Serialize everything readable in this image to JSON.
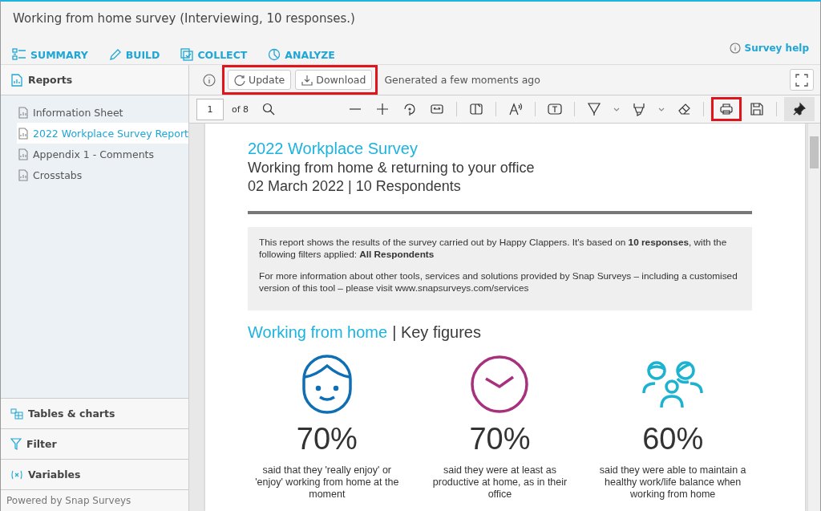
{
  "window": {
    "title": "Working from home survey (Interviewing, 10 responses.)"
  },
  "nav_tabs": [
    {
      "label": "SUMMARY",
      "kind": "summary"
    },
    {
      "label": "BUILD",
      "kind": "build"
    },
    {
      "label": "COLLECT",
      "kind": "collect"
    },
    {
      "label": "ANALYZE",
      "kind": "analyze"
    }
  ],
  "help_link": "Survey help",
  "sidebar": {
    "title": "Reports",
    "items": [
      {
        "label": "Information Sheet",
        "selected": false
      },
      {
        "label": "2022 Workplace Survey Report",
        "selected": true
      },
      {
        "label": "Appendix 1 - Comments",
        "selected": false
      },
      {
        "label": "Crosstabs",
        "selected": false
      }
    ],
    "sections": [
      {
        "label": "Tables & charts",
        "kind": "tables"
      },
      {
        "label": "Filter",
        "kind": "filter"
      },
      {
        "label": "Variables",
        "kind": "variables"
      }
    ],
    "footer": "Powered by Snap Surveys"
  },
  "report_toolbar": {
    "highlighted": true,
    "buttons": [
      {
        "label": "Update",
        "kind": "refresh"
      },
      {
        "label": "Download",
        "kind": "download"
      }
    ],
    "status": "Generated a few moments ago"
  },
  "pdf_toolbar": {
    "page": "1",
    "page_count": "of 8",
    "tools": [
      {
        "kind": "search",
        "highlighted": false,
        "selected": false
      },
      {
        "kind": "spacer"
      },
      {
        "kind": "zoom-out",
        "highlighted": false,
        "selected": false
      },
      {
        "kind": "zoom-in",
        "highlighted": false,
        "selected": false
      },
      {
        "kind": "rotate",
        "highlighted": false,
        "selected": false
      },
      {
        "kind": "fit-width",
        "highlighted": false,
        "selected": false
      },
      {
        "kind": "divider"
      },
      {
        "kind": "page-view",
        "highlighted": false,
        "selected": false
      },
      {
        "kind": "divider"
      },
      {
        "kind": "read-aloud",
        "highlighted": false,
        "selected": false
      },
      {
        "kind": "divider"
      },
      {
        "kind": "text-box",
        "highlighted": false,
        "selected": false
      },
      {
        "kind": "divider"
      },
      {
        "kind": "draw",
        "highlighted": false,
        "selected": false
      },
      {
        "kind": "caret",
        "highlighted": false,
        "selected": false
      },
      {
        "kind": "highlighter",
        "highlighted": false,
        "selected": false
      },
      {
        "kind": "caret",
        "highlighted": false,
        "selected": false
      },
      {
        "kind": "eraser",
        "highlighted": false,
        "selected": false
      },
      {
        "kind": "divider"
      },
      {
        "kind": "print",
        "highlighted": true,
        "selected": false
      },
      {
        "kind": "save",
        "highlighted": false,
        "selected": false
      },
      {
        "kind": "divider"
      },
      {
        "kind": "pin",
        "highlighted": false,
        "selected": true
      }
    ]
  },
  "document": {
    "title": "2022 Workplace Survey",
    "subtitle": "Working from home & returning to your office",
    "date_line": "02 March 2022 | 10 Respondents",
    "paragraphs": [
      "This report shows the results of the survey carried out by Happy Clappers. It's based on **10 responses**, with the following filters applied: **All Respondents**",
      "For more information about other tools, services and solutions provided by Snap Surveys – including a customised version of this tool – please visit www.snapsurveys.com/services"
    ],
    "section_heading_accent": "Working from home",
    "section_heading_rest": "| Key figures",
    "figures": [
      {
        "kind": "face",
        "color": "#0e6fb5",
        "value": "70%",
        "text": "said that they 'really enjoy' or 'enjoy' working from home at the moment"
      },
      {
        "kind": "clock",
        "color": "#a8317e",
        "value": "70%",
        "text": "said they were at least as productive at home, as in their office"
      },
      {
        "kind": "people",
        "color": "#1bb3cf",
        "value": "60%",
        "text": "said they were able to maintain a healthy work/life balance when working from home"
      }
    ]
  }
}
